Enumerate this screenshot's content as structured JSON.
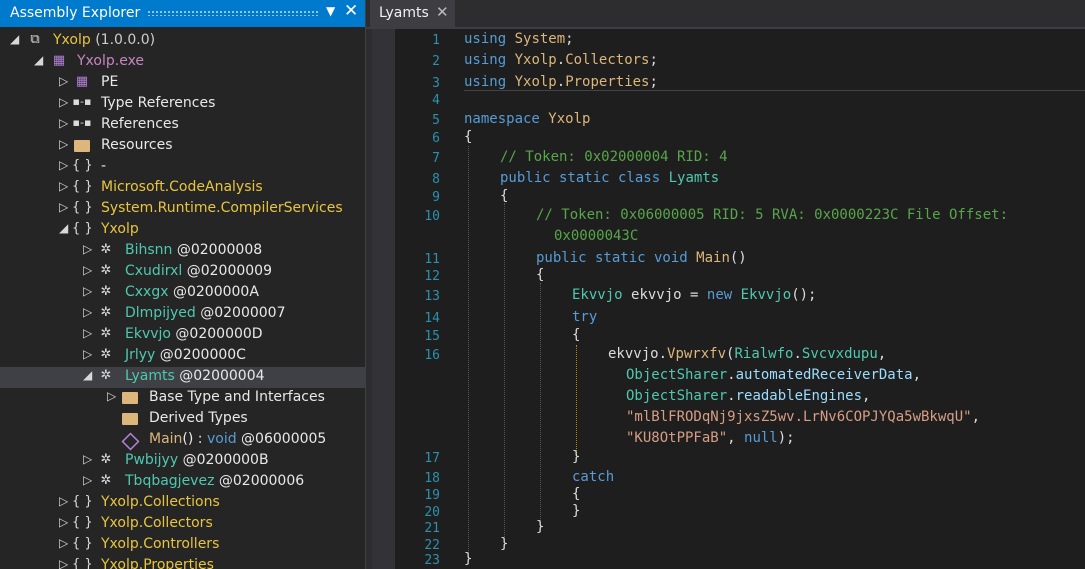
{
  "explorer": {
    "title": "Assembly Explorer",
    "dropdown_glyph": "▼",
    "close_glyph": "✕",
    "rows": [
      {
        "text": "Yxolp",
        "extra": " (1.0.0.0)",
        "icon": "assembly-icon"
      },
      {
        "text": "Yxolp.exe",
        "icon": "module-icon"
      },
      {
        "text": "PE",
        "icon": "pe-icon"
      },
      {
        "text": "Type References",
        "icon": "reference-icon"
      },
      {
        "text": "References",
        "icon": "reference-icon"
      },
      {
        "text": "Resources",
        "icon": "folder-icon"
      },
      {
        "text": "-",
        "icon": "namespace-icon"
      },
      {
        "text": "Microsoft.CodeAnalysis",
        "icon": "namespace-icon"
      },
      {
        "text": "System.Runtime.CompilerServices",
        "icon": "namespace-icon"
      },
      {
        "text": "Yxolp",
        "icon": "namespace-icon"
      },
      {
        "text": "Bihsnn",
        "extra": " @02000008",
        "icon": "class-icon"
      },
      {
        "text": "Cxudirxl",
        "extra": " @02000009",
        "icon": "class-icon"
      },
      {
        "text": "Cxxgx",
        "extra": " @0200000A",
        "icon": "class-icon"
      },
      {
        "text": "Dlmpijyed",
        "extra": " @02000007",
        "icon": "class-icon"
      },
      {
        "text": "Ekvvjo",
        "extra": " @0200000D",
        "icon": "class-icon"
      },
      {
        "text": "Jrlyy",
        "extra": " @0200000C",
        "icon": "class-icon"
      },
      {
        "text": "Lyamts",
        "extra": " @02000004",
        "icon": "class-icon"
      },
      {
        "text": "Base Type and Interfaces",
        "icon": "folder-icon"
      },
      {
        "text": "Derived Types",
        "icon": "folder-icon"
      },
      {
        "text": "Main",
        "extra": "() : ",
        "extra2": "void",
        "extra3": " @06000005",
        "icon": "method-icon"
      },
      {
        "text": "Pwbijyy",
        "extra": " @0200000B",
        "icon": "class-icon"
      },
      {
        "text": "Tbqbagjevez",
        "extra": " @02000006",
        "icon": "class-icon"
      },
      {
        "text": "Yxolp.Collections",
        "icon": "namespace-icon"
      },
      {
        "text": "Yxolp.Collectors",
        "icon": "namespace-icon"
      },
      {
        "text": "Yxolp.Controllers",
        "icon": "namespace-icon"
      },
      {
        "text": "Yxolp.Properties",
        "icon": "namespace-icon"
      }
    ]
  },
  "tab": {
    "label": "Lyamts",
    "close": "✕"
  },
  "code": {
    "line_numbers": [
      "1",
      "2",
      "3",
      "4",
      "5",
      "6",
      "7",
      "8",
      "9",
      "10",
      "11",
      "12",
      "13",
      "14",
      "15",
      "16",
      "17",
      "18",
      "19",
      "20",
      "21",
      "22",
      "23"
    ],
    "l1a": "using",
    "l1b": "System",
    "l2a": "using",
    "l2b": "Yxolp",
    "l2c": "Collectors",
    "l3a": "using",
    "l3b": "Yxolp",
    "l3c": "Properties",
    "l5a": "namespace",
    "l5b": "Yxolp",
    "l6": "{",
    "l7": "// Token: 0x02000004 RID: 4",
    "l8a": "public static class",
    "l8b": "Lyamts",
    "l9": "{",
    "l10": "// Token: 0x06000005 RID: 5 RVA: 0x0000223C File Offset:",
    "l10b": "0x0000043C",
    "l11a": "public static void",
    "l11b": "Main",
    "l12": "{",
    "l13a": "Ekvvjo",
    "l13b": "ekvvjo",
    "l13c": "new",
    "l13d": "Ekvvjo",
    "l14": "try",
    "l15": "{",
    "l16a": "ekvvjo",
    "l16b": "Vpwrxfv",
    "l16c": "Rialwfo",
    "l16d": "Svcvxdupu",
    "l16e": "ObjectSharer",
    "l16f": "automatedReceiverData",
    "l16g": "ObjectSharer",
    "l16h": "readableEngines",
    "l16i": "\"mlBlFRODqNj9jxsZ5wv.LrNv6COPJYQa5wBkwqU\"",
    "l16j": "\"KU8OtPPFaB\"",
    "l16k": "null",
    "l17": "}",
    "l18": "catch",
    "l19": "{",
    "l20": "}",
    "l21": "}",
    "l22": "}",
    "l23": "}"
  }
}
